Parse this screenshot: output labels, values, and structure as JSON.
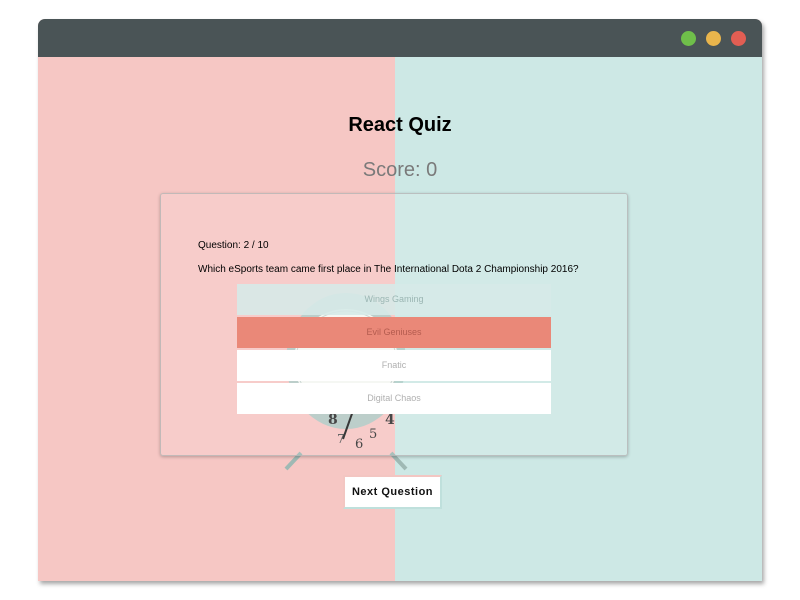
{
  "window": {
    "controls": [
      {
        "name": "green",
        "color": "#6fbf4a"
      },
      {
        "name": "yellow",
        "color": "#e9b54c"
      },
      {
        "name": "red",
        "color": "#e25e53"
      }
    ]
  },
  "background": {
    "left_color": "#f6c7c4",
    "right_color": "#cde8e5"
  },
  "quiz": {
    "title": "React Quiz",
    "score_label": "Score: 0",
    "question_counter": "Question: 2 / 10",
    "question": "Which eSports team came first place in The International Dota 2 Championship 2016?",
    "answers": [
      "Wings Gaming",
      "Evil Geniuses",
      "Fnatic",
      "Digital Chaos"
    ],
    "next_label": "Next Question"
  }
}
